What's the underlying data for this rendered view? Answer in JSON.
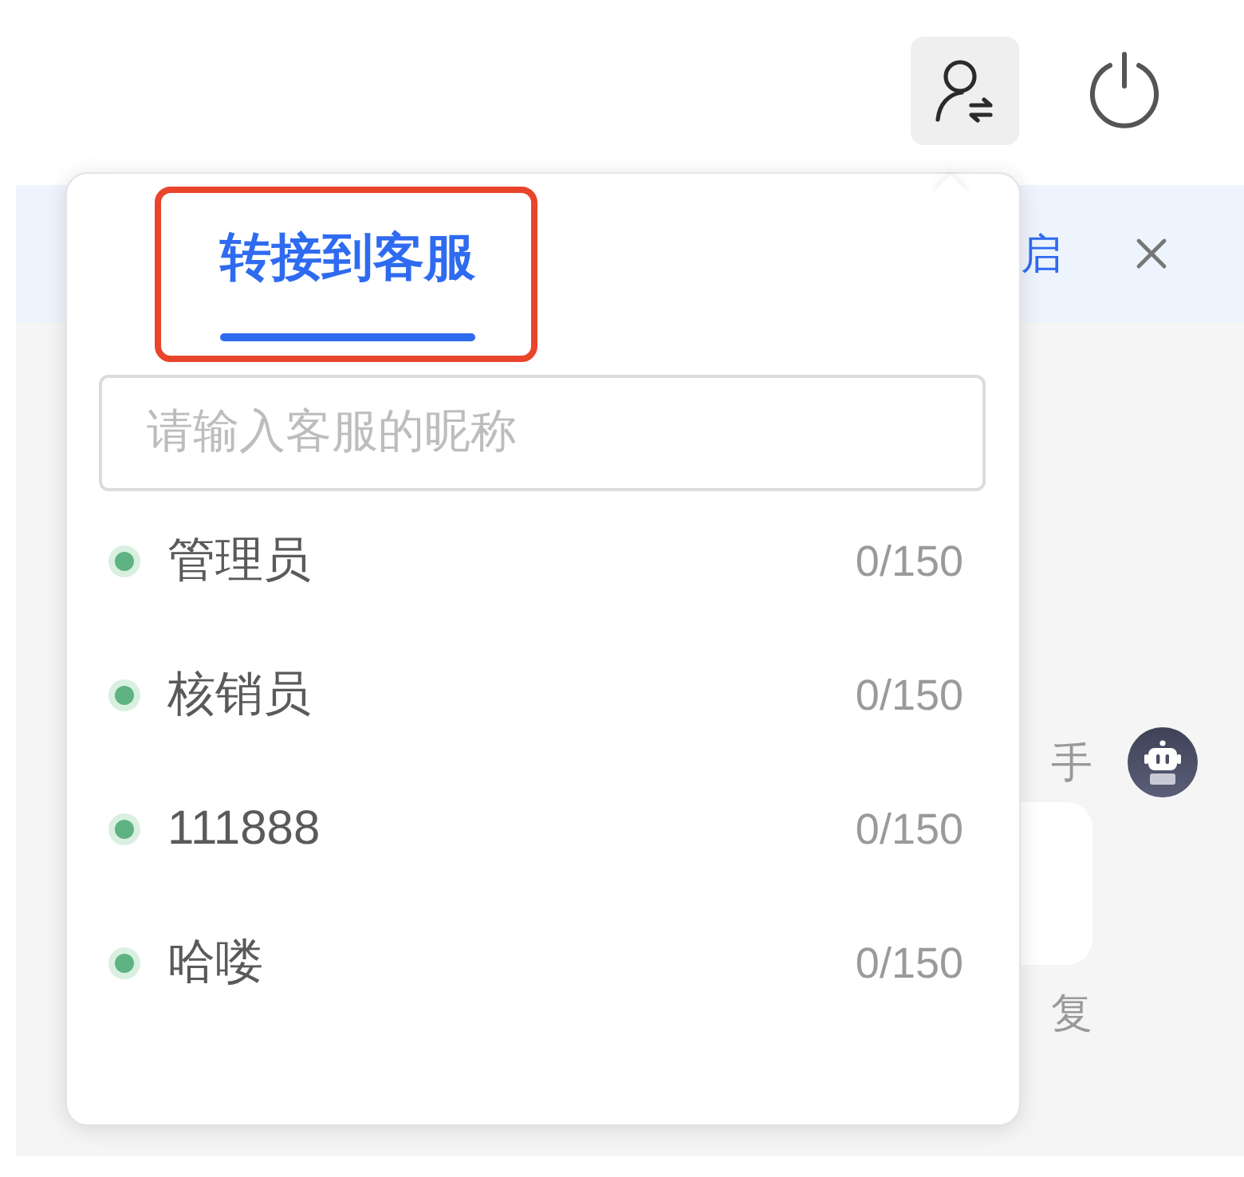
{
  "header": {
    "buttons": [
      {
        "kind": "transfer",
        "selected": true
      },
      {
        "kind": "power",
        "selected": false
      }
    ]
  },
  "background": {
    "notice_text": "启",
    "assistant_label": "手",
    "reply_label": "复"
  },
  "popup": {
    "tabs": [
      {
        "label": "转接到客服",
        "selected": true
      }
    ],
    "search": {
      "placeholder": "请输入客服的昵称"
    },
    "agents": [
      {
        "name": "管理员",
        "load": "0/150",
        "online": true
      },
      {
        "name": "核销员",
        "load": "0/150",
        "online": true
      },
      {
        "name": "111888",
        "load": "0/150",
        "online": true
      },
      {
        "name": "哈喽",
        "load": "0/150",
        "online": true
      }
    ]
  }
}
